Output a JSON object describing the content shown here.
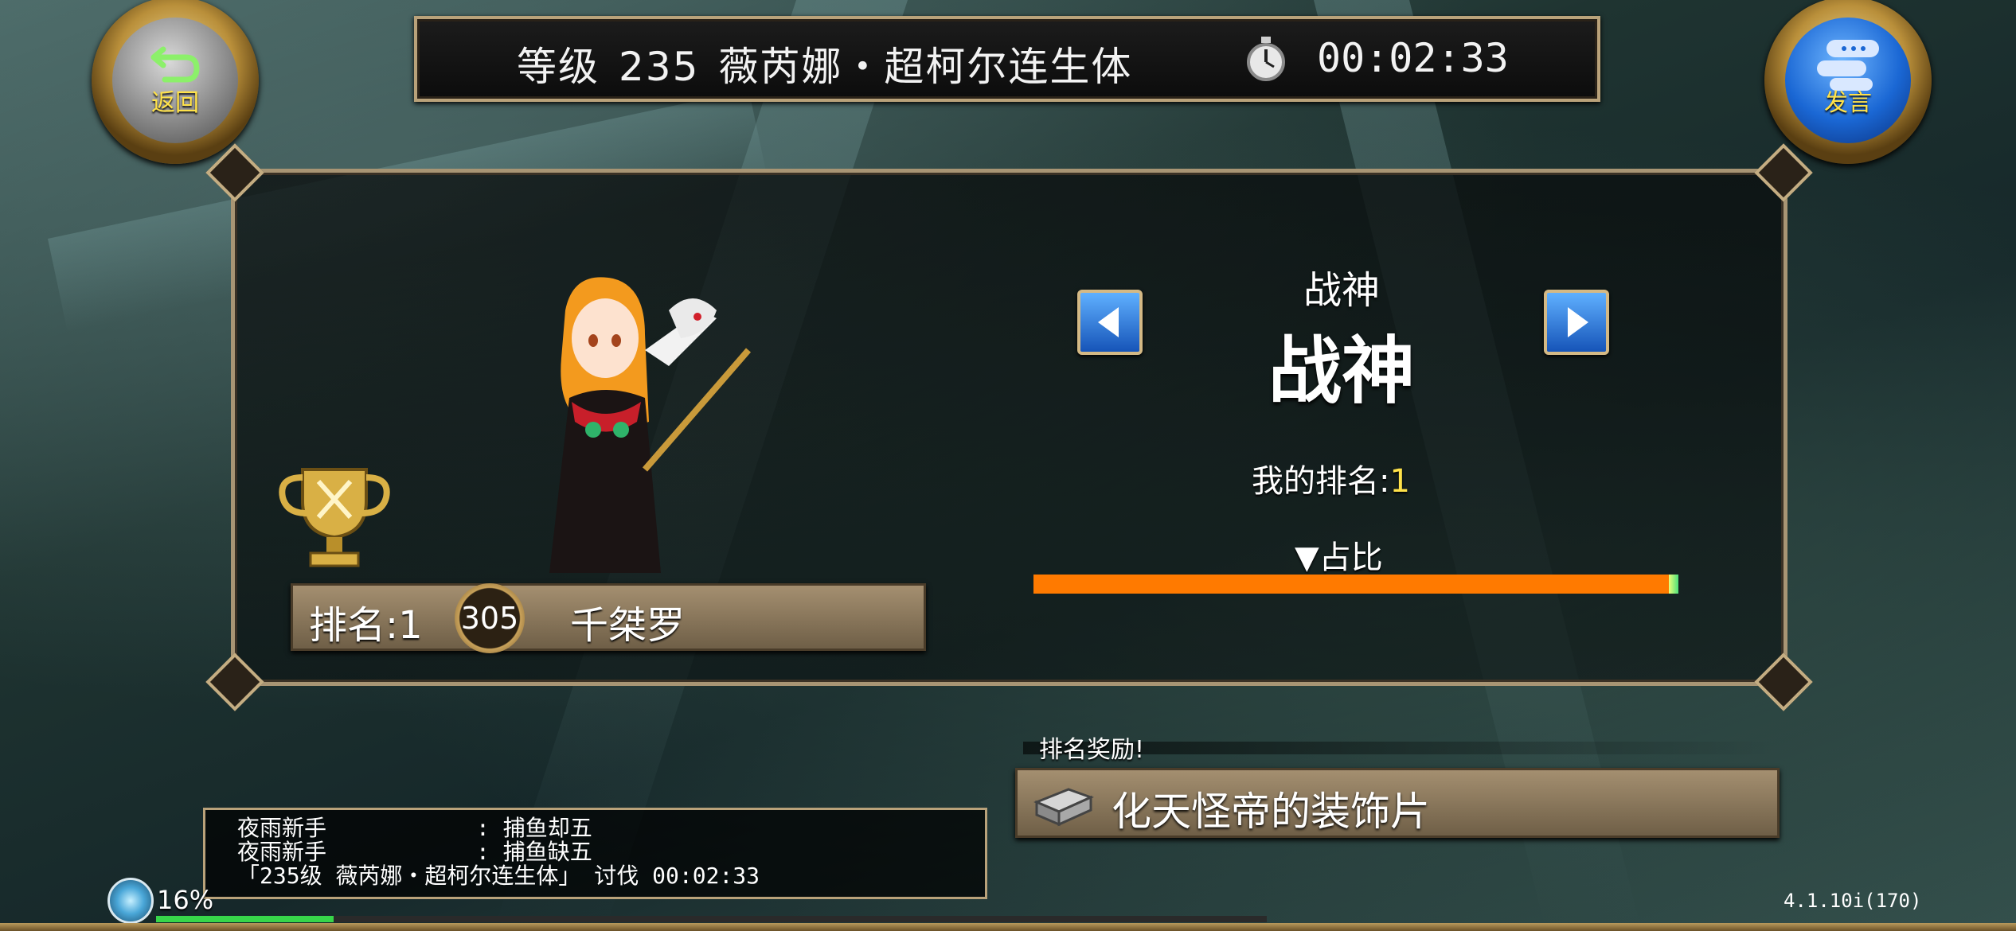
{
  "header": {
    "level_label": "等级",
    "level": "235",
    "boss_name": "薇芮娜・超柯尔连生体",
    "timer": "00:02:33"
  },
  "buttons": {
    "back_label": "返回",
    "speak_label": "发言"
  },
  "ranking": {
    "rank_text": "排名:1",
    "player_level": "305",
    "player_name": "千桀罗"
  },
  "category": {
    "small": "战神",
    "big": "战神"
  },
  "my_rank": {
    "label": "我的排名:",
    "value": "1"
  },
  "share": {
    "label": "▼占比",
    "fill_fraction": 0.985
  },
  "reward": {
    "label": "排名奖励!",
    "item_name": "化天怪帝的装饰片"
  },
  "chat": [
    {
      "name": "夜雨新手",
      "message": ": 捕鱼却五"
    },
    {
      "name": "夜雨新手",
      "message": ": 捕鱼缺五"
    },
    {
      "name": "",
      "message": "「235级 薇芮娜・超柯尔连生体」 讨伐 00:02:33"
    }
  ],
  "exp": {
    "percent": "16%",
    "fill_fraction": 0.16
  },
  "version": "4.1.10i(170)",
  "colors": {
    "gold": "#ffe24a",
    "share_bar": "#ff7a00",
    "exp_bar": "#37d64a",
    "frame": "#b9a27a"
  },
  "icons": {
    "back": "back-arrow-icon",
    "speak": "chat-bubble-icon",
    "timer": "stopwatch-icon",
    "trophy": "trophy-icon",
    "prev": "left-arrow-icon",
    "next": "right-arrow-icon",
    "reward": "metal-ingot-icon",
    "expand": "orb-icon"
  }
}
